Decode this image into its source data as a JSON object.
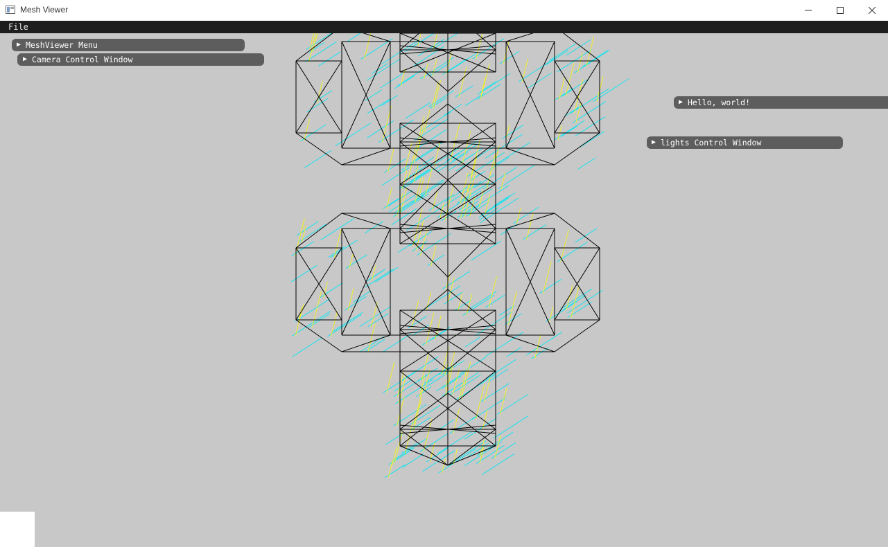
{
  "window": {
    "title": "Mesh Viewer",
    "icon": "app-window-icon",
    "controls": [
      "minimize-icon",
      "maximize-icon",
      "close-icon"
    ]
  },
  "menubar": {
    "file_label": "File"
  },
  "panels": {
    "meshviewer_menu": {
      "label": "MeshViewer Menu",
      "collapsed": true,
      "icon": "collapse-arrow-icon"
    },
    "camera_control": {
      "label": "Camera Control Window",
      "collapsed": true,
      "icon": "collapse-arrow-icon"
    },
    "hello_world": {
      "label": "Hello, world!",
      "collapsed": true,
      "icon": "collapse-arrow-icon"
    },
    "lights_control": {
      "label": "lights Control Window",
      "collapsed": true,
      "icon": "collapse-arrow-icon"
    }
  },
  "scene": {
    "background_color": "#c8c8c8",
    "wireframe_color": "#000000",
    "normals_color_primary": "#00e5ff",
    "normals_color_secondary": "#ffff00"
  }
}
